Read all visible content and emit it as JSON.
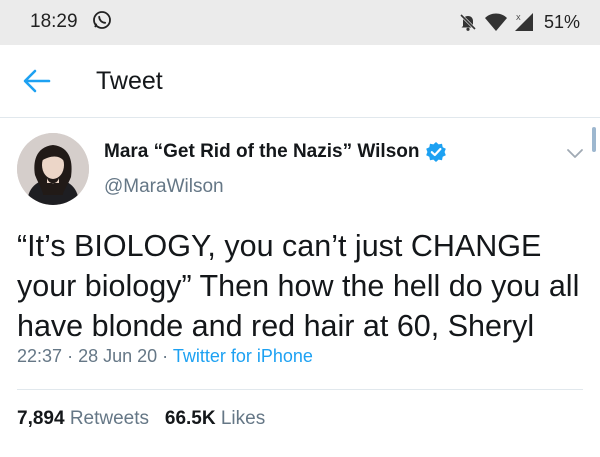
{
  "status_bar": {
    "time": "18:29",
    "battery": "51%",
    "icons": [
      "whatsapp-icon",
      "bell-off-icon",
      "wifi-icon",
      "signal-icon"
    ]
  },
  "header": {
    "title": "Tweet",
    "back_icon": "arrow-left-icon"
  },
  "tweet": {
    "display_name": "Mara “Get Rid of the Nazis” Wilson",
    "handle": "@MaraWilson",
    "verified": true,
    "text": "“It’s BIOLOGY, you can’t just CHANGE your biology” Then how the hell do you all have blonde and red hair at 60, Sheryl",
    "time": "22:37",
    "date": "28 Jun 20",
    "source": "Twitter for iPhone",
    "retweets_count": "7,894",
    "retweets_label": "Retweets",
    "likes_count": "66.5K",
    "likes_label": "Likes"
  },
  "colors": {
    "accent": "#1da1f2",
    "secondary_text": "#657786",
    "primary_text": "#14171a",
    "status_bar_bg": "#ebebeb"
  }
}
